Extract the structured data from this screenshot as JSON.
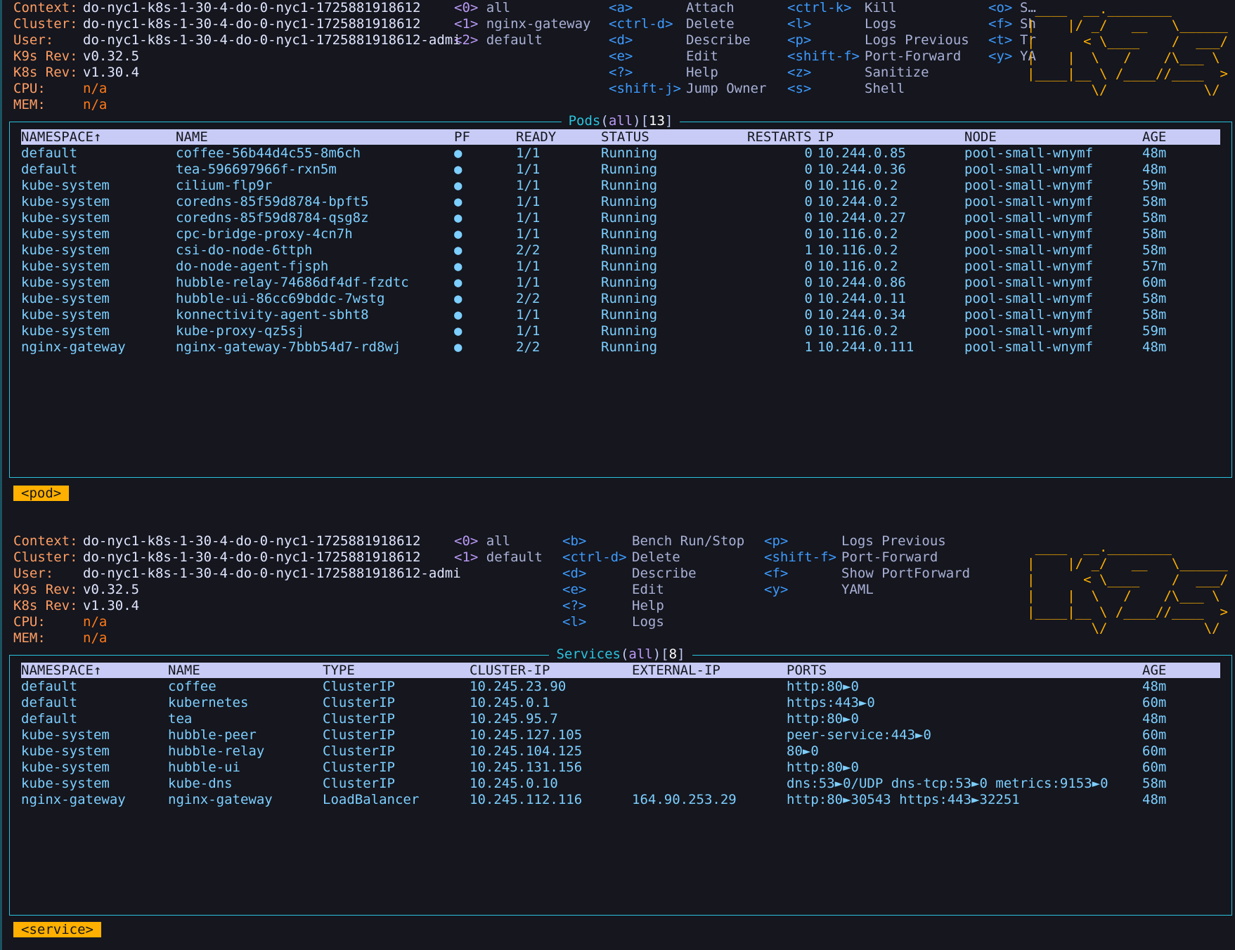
{
  "top": {
    "info": [
      {
        "label": "Context:",
        "value": "do-nyc1-k8s-1-30-4-do-0-nyc1-1725881918612"
      },
      {
        "label": "Cluster:",
        "value": "do-nyc1-k8s-1-30-4-do-0-nyc1-1725881918612"
      },
      {
        "label": "User:",
        "value": "do-nyc1-k8s-1-30-4-do-0-nyc1-1725881918612-admi"
      },
      {
        "label": "K9s Rev:",
        "value": "v0.32.5"
      },
      {
        "label": "K8s Rev:",
        "value": "v1.30.4"
      },
      {
        "label": "CPU:",
        "value": "n/a"
      },
      {
        "label": "MEM:",
        "value": "n/a"
      }
    ],
    "namespaces": [
      {
        "key": "<0>",
        "name": "all"
      },
      {
        "key": "<1>",
        "name": "nginx-gateway"
      },
      {
        "key": "<2>",
        "name": "default"
      }
    ],
    "hints_col1": [
      {
        "key": "<a>",
        "action": "Attach"
      },
      {
        "key": "<ctrl-d>",
        "action": "Delete"
      },
      {
        "key": "<d>",
        "action": "Describe"
      },
      {
        "key": "<e>",
        "action": "Edit"
      },
      {
        "key": "<?>",
        "action": "Help"
      },
      {
        "key": "<shift-j>",
        "action": "Jump Owner"
      }
    ],
    "hints_col2": [
      {
        "key": "<ctrl-k>",
        "action": "Kill"
      },
      {
        "key": "<l>",
        "action": "Logs"
      },
      {
        "key": "<p>",
        "action": "Logs Previous"
      },
      {
        "key": "<shift-f>",
        "action": "Port-Forward"
      },
      {
        "key": "<z>",
        "action": "Sanitize"
      },
      {
        "key": "<s>",
        "action": "Shell"
      }
    ],
    "hints_col3": [
      {
        "key": "<o>",
        "action": "S…"
      },
      {
        "key": "<f>",
        "action": "Sh"
      },
      {
        "key": "<t>",
        "action": "Tr"
      },
      {
        "key": "<y>",
        "action": "YA"
      }
    ],
    "title": {
      "resource": "Pods",
      "filter": "all",
      "count": "13"
    },
    "columns": [
      "NAMESPACE↑",
      "NAME",
      "PF",
      "READY",
      "STATUS",
      "RESTARTS",
      "IP",
      "NODE",
      "AGE"
    ],
    "rows": [
      [
        "default",
        "coffee-56b44d4c55-8m6ch",
        "●",
        "1/1",
        "Running",
        "0",
        "10.244.0.85",
        "pool-small-wnymf",
        "48m"
      ],
      [
        "default",
        "tea-596697966f-rxn5m",
        "●",
        "1/1",
        "Running",
        "0",
        "10.244.0.36",
        "pool-small-wnymf",
        "48m"
      ],
      [
        "kube-system",
        "cilium-flp9r",
        "●",
        "1/1",
        "Running",
        "0",
        "10.116.0.2",
        "pool-small-wnymf",
        "59m"
      ],
      [
        "kube-system",
        "coredns-85f59d8784-bpft5",
        "●",
        "1/1",
        "Running",
        "0",
        "10.244.0.2",
        "pool-small-wnymf",
        "58m"
      ],
      [
        "kube-system",
        "coredns-85f59d8784-qsg8z",
        "●",
        "1/1",
        "Running",
        "0",
        "10.244.0.27",
        "pool-small-wnymf",
        "58m"
      ],
      [
        "kube-system",
        "cpc-bridge-proxy-4cn7h",
        "●",
        "1/1",
        "Running",
        "0",
        "10.116.0.2",
        "pool-small-wnymf",
        "58m"
      ],
      [
        "kube-system",
        "csi-do-node-6ttph",
        "●",
        "2/2",
        "Running",
        "1",
        "10.116.0.2",
        "pool-small-wnymf",
        "58m"
      ],
      [
        "kube-system",
        "do-node-agent-fjsph",
        "●",
        "1/1",
        "Running",
        "0",
        "10.116.0.2",
        "pool-small-wnymf",
        "57m"
      ],
      [
        "kube-system",
        "hubble-relay-74686df4df-fzdtc",
        "●",
        "1/1",
        "Running",
        "0",
        "10.244.0.86",
        "pool-small-wnymf",
        "60m"
      ],
      [
        "kube-system",
        "hubble-ui-86cc69bddc-7wstg",
        "●",
        "2/2",
        "Running",
        "0",
        "10.244.0.11",
        "pool-small-wnymf",
        "58m"
      ],
      [
        "kube-system",
        "konnectivity-agent-sbht8",
        "●",
        "1/1",
        "Running",
        "0",
        "10.244.0.34",
        "pool-small-wnymf",
        "58m"
      ],
      [
        "kube-system",
        "kube-proxy-qz5sj",
        "●",
        "1/1",
        "Running",
        "0",
        "10.116.0.2",
        "pool-small-wnymf",
        "59m"
      ],
      [
        "nginx-gateway",
        "nginx-gateway-7bbb54d7-rd8wj",
        "●",
        "2/2",
        "Running",
        "1",
        "10.244.0.111",
        "pool-small-wnymf",
        "48m"
      ]
    ],
    "crumb": "<pod>"
  },
  "bottom": {
    "info": [
      {
        "label": "Context:",
        "value": "do-nyc1-k8s-1-30-4-do-0-nyc1-1725881918612"
      },
      {
        "label": "Cluster:",
        "value": "do-nyc1-k8s-1-30-4-do-0-nyc1-1725881918612"
      },
      {
        "label": "User:",
        "value": "do-nyc1-k8s-1-30-4-do-0-nyc1-1725881918612-admi"
      },
      {
        "label": "K9s Rev:",
        "value": "v0.32.5"
      },
      {
        "label": "K8s Rev:",
        "value": "v1.30.4"
      },
      {
        "label": "CPU:",
        "value": "n/a"
      },
      {
        "label": "MEM:",
        "value": "n/a"
      }
    ],
    "namespaces": [
      {
        "key": "<0>",
        "name": "all"
      },
      {
        "key": "<1>",
        "name": "default"
      }
    ],
    "hints_col1": [
      {
        "key": "<b>",
        "action": "Bench Run/Stop"
      },
      {
        "key": "<ctrl-d>",
        "action": "Delete"
      },
      {
        "key": "<d>",
        "action": "Describe"
      },
      {
        "key": "<e>",
        "action": "Edit"
      },
      {
        "key": "<?>",
        "action": "Help"
      },
      {
        "key": "<l>",
        "action": "Logs"
      }
    ],
    "hints_col2": [
      {
        "key": "<p>",
        "action": "Logs Previous"
      },
      {
        "key": "<shift-f>",
        "action": "Port-Forward"
      },
      {
        "key": "<f>",
        "action": "Show PortForward"
      },
      {
        "key": "<y>",
        "action": "YAML"
      }
    ],
    "title": {
      "resource": "Services",
      "filter": "all",
      "count": "8"
    },
    "columns": [
      "NAMESPACE↑",
      "NAME",
      "TYPE",
      "CLUSTER-IP",
      "EXTERNAL-IP",
      "PORTS",
      "AGE"
    ],
    "rows": [
      [
        "default",
        "coffee",
        "ClusterIP",
        "10.245.23.90",
        "",
        "http:80►0",
        "48m"
      ],
      [
        "default",
        "kubernetes",
        "ClusterIP",
        "10.245.0.1",
        "",
        "https:443►0",
        "60m"
      ],
      [
        "default",
        "tea",
        "ClusterIP",
        "10.245.95.7",
        "",
        "http:80►0",
        "48m"
      ],
      [
        "kube-system",
        "hubble-peer",
        "ClusterIP",
        "10.245.127.105",
        "",
        "peer-service:443►0",
        "60m"
      ],
      [
        "kube-system",
        "hubble-relay",
        "ClusterIP",
        "10.245.104.125",
        "",
        "80►0",
        "60m"
      ],
      [
        "kube-system",
        "hubble-ui",
        "ClusterIP",
        "10.245.131.156",
        "",
        "http:80►0",
        "60m"
      ],
      [
        "kube-system",
        "kube-dns",
        "ClusterIP",
        "10.245.0.10",
        "",
        "dns:53►0/UDP dns-tcp:53►0 metrics:9153►0",
        "58m"
      ],
      [
        "nginx-gateway",
        "nginx-gateway",
        "LoadBalancer",
        "10.245.112.116",
        "164.90.253.29",
        "http:80►30543 https:443►32251",
        "48m"
      ]
    ],
    "crumb": "<service>"
  },
  "logo_art": " ____  __.________       \n|    |/ _/   __   \\______\n|      < \\____    /  ___/\n|    |  \\   /    /\\___ \\ \n|____|__ \\ /____//____  >\n        \\/            \\/ "
}
